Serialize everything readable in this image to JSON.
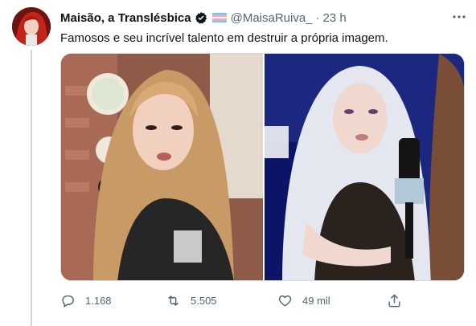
{
  "tweet": {
    "display_name": "Maisão, a Translésbica",
    "handle": "@MaisaRuiva_",
    "separator": "·",
    "time": "23 h",
    "text": "Famosos e seu incrível talento em destruir a própria imagem."
  },
  "icons": {
    "verified": "verified-badge-icon",
    "flag": "transgender-flag-icon",
    "more": "more-options-icon",
    "reply": "reply-icon",
    "retweet": "retweet-icon",
    "like": "heart-icon",
    "share": "share-icon"
  },
  "actions": {
    "replies": "1.168",
    "retweets": "5.505",
    "likes": "49 mil"
  },
  "colors": {
    "text": "#0f1419",
    "secondary": "#536471",
    "border": "#cfd9de",
    "flag_blue": "#5bcefa",
    "flag_pink": "#f5a9b8"
  }
}
